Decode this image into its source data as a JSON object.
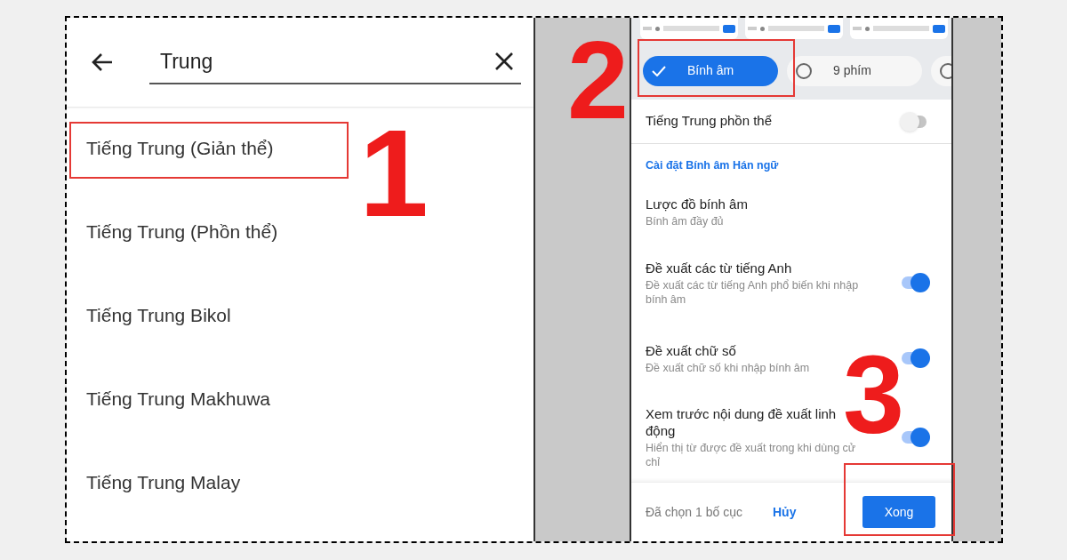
{
  "left_screen": {
    "search": {
      "value": "Trung"
    },
    "results": [
      {
        "label": "Tiếng Trung (Giản thể)"
      },
      {
        "label": "Tiếng Trung (Phồn thể)"
      },
      {
        "label": "Tiếng Trung Bikol"
      },
      {
        "label": "Tiếng Trung Makhuwa"
      },
      {
        "label": "Tiếng Trung Malay"
      }
    ]
  },
  "right_screen": {
    "keyboard_previews": [
      {
        "kind": "keyboard"
      },
      {
        "kind": "keyboard"
      },
      {
        "kind": "keyboard"
      }
    ],
    "layouts": [
      {
        "label": "Bính âm",
        "selected": true
      },
      {
        "label": "9 phím",
        "selected": false
      },
      {
        "selected": false
      }
    ],
    "traditional_toggle": {
      "label": "Tiếng Trung phồn thể",
      "on": false
    },
    "section_heading": "Cài đặt Bính âm Hán ngữ",
    "settings": [
      {
        "kind": "info",
        "title": "Lược đồ bính âm",
        "subtitle": "Bính âm đầy đủ"
      },
      {
        "kind": "toggle",
        "title": "Đề xuất các từ tiếng Anh",
        "subtitle": "Đề xuất các từ tiếng Anh phổ biến khi nhập bính âm",
        "on": true
      },
      {
        "kind": "toggle",
        "title": "Đề xuất chữ số",
        "subtitle": "Đề xuất chữ số khi nhập bính âm",
        "on": true
      },
      {
        "kind": "toggle",
        "title": "Xem trước nội dung đề xuất linh động",
        "subtitle": "Hiển thị từ được đề xuất trong khi dùng cử chỉ",
        "on": true
      }
    ],
    "footer": {
      "status": "Đã chọn 1 bố cục",
      "cancel": "Hủy",
      "done": "Xong"
    }
  },
  "step_numbers": [
    "1",
    "2",
    "3"
  ]
}
